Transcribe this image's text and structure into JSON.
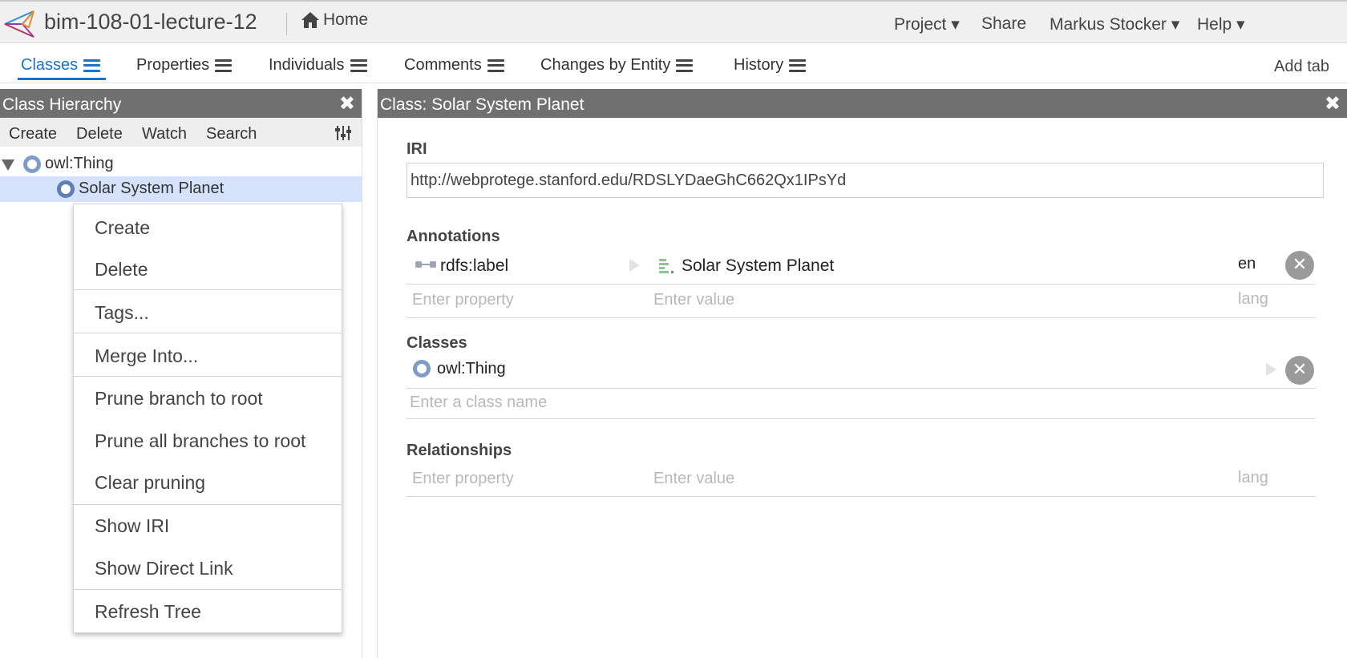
{
  "topbar": {
    "project_title": "bim-108-01-lecture-12",
    "home_label": "Home",
    "menu": {
      "project": "Project ▾",
      "share": "Share",
      "user": "Markus Stocker ▾",
      "help": "Help ▾"
    }
  },
  "tabs": {
    "items": [
      "Classes",
      "Properties",
      "Individuals",
      "Comments",
      "Changes by Entity",
      "History"
    ],
    "active": "Classes",
    "add_tab": "Add tab"
  },
  "hierarchy": {
    "title": "Class Hierarchy",
    "toolbar": [
      "Create",
      "Delete",
      "Watch",
      "Search"
    ],
    "tree": {
      "root": "owl:Thing",
      "child": "Solar System Planet"
    }
  },
  "context_menu": {
    "items": [
      "Create",
      "Delete",
      "Tags...",
      "Merge Into...",
      "Prune branch to root",
      "Prune all branches to root",
      "Clear pruning",
      "Show IRI",
      "Show Direct Link",
      "Refresh Tree"
    ]
  },
  "class_editor": {
    "title": "Class: Solar System Planet",
    "iri_label": "IRI",
    "iri_value": "http://webprotege.stanford.edu/RDSLYDaeGhC662Qx1IPsYd",
    "annotations_label": "Annotations",
    "annotation": {
      "property": "rdfs:label",
      "value": "Solar System Planet",
      "lang": "en"
    },
    "placeholders": {
      "property": "Enter property",
      "value": "Enter value",
      "lang": "lang",
      "class_name": "Enter a class name"
    },
    "classes_label": "Classes",
    "class_item": "owl:Thing",
    "relationships_label": "Relationships"
  },
  "colors": {
    "accent": "#1a73c8",
    "panel_header": "#707070",
    "selection": "#d4e3fb",
    "class_icon": "#7f9cc6"
  }
}
